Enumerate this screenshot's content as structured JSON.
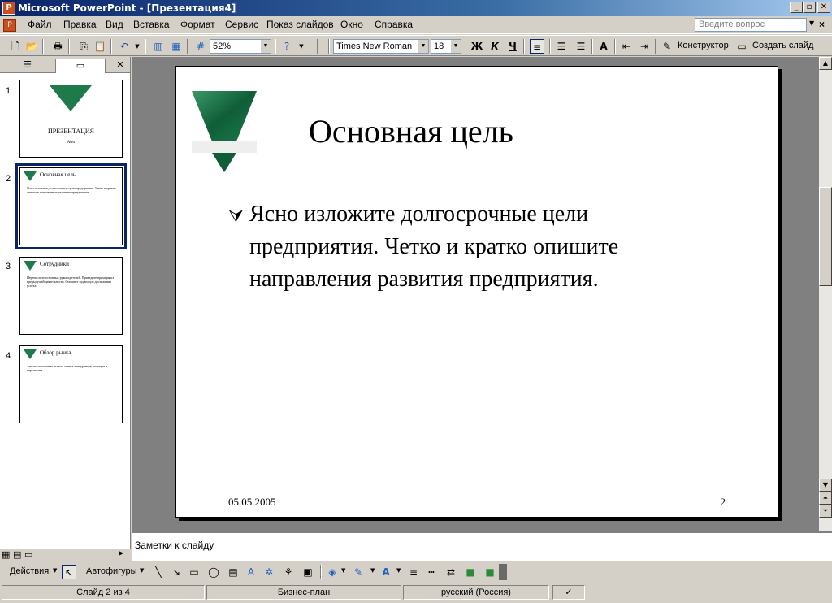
{
  "window": {
    "title": "Microsoft PowerPoint - [Презентация4]",
    "min": "_",
    "restore": "▫",
    "close": "✕"
  },
  "menu": {
    "items": [
      "Файл",
      "Правка",
      "Вид",
      "Вставка",
      "Формат",
      "Сервис",
      "Показ слайдов",
      "Окно",
      "Справка"
    ],
    "ask_placeholder": "Введите вопрос",
    "close": "×"
  },
  "toolbar": {
    "zoom": "52%",
    "font": "Times New Roman",
    "size": "18",
    "bold": "Ж",
    "italic": "К",
    "underline": "Ч",
    "grow": "A",
    "designer": "Конструктор",
    "new_slide": "Создать слайд"
  },
  "panel": {
    "close": "✕"
  },
  "thumbnails": [
    {
      "num": "1",
      "title": "ПРЕЗЕНТАЦИЯ",
      "sub": "Alex"
    },
    {
      "num": "2",
      "title": "Основная цель",
      "body": "Ясно изложите долгосрочные цели предприятия. Четко и кратко опишите направления развития предприятия"
    },
    {
      "num": "3",
      "title": "Сотрудники",
      "body": "Перечислите основных руководителей. Приведите примеры из предыдущей деятельности. Опишите задачи для достижения успеха"
    },
    {
      "num": "4",
      "title": "Обзор рынка",
      "body": "Анализ положения рынка: оценка конкурентов, позиции и перспектив"
    }
  ],
  "slide": {
    "title": "Основная цель",
    "bullet": "Ясно изложите долгосрочные цели предприятия. Четко и кратко опишите направления развития предприятия.",
    "date": "05.05.2005",
    "page": "2"
  },
  "notes": {
    "placeholder": "Заметки к слайду"
  },
  "drawbar": {
    "actions": "Действия",
    "autoshapes": "Автофигуры"
  },
  "status": {
    "slide": "Слайд 2 из 4",
    "design": "Бизнес-план",
    "lang": "русский (Россия)"
  }
}
